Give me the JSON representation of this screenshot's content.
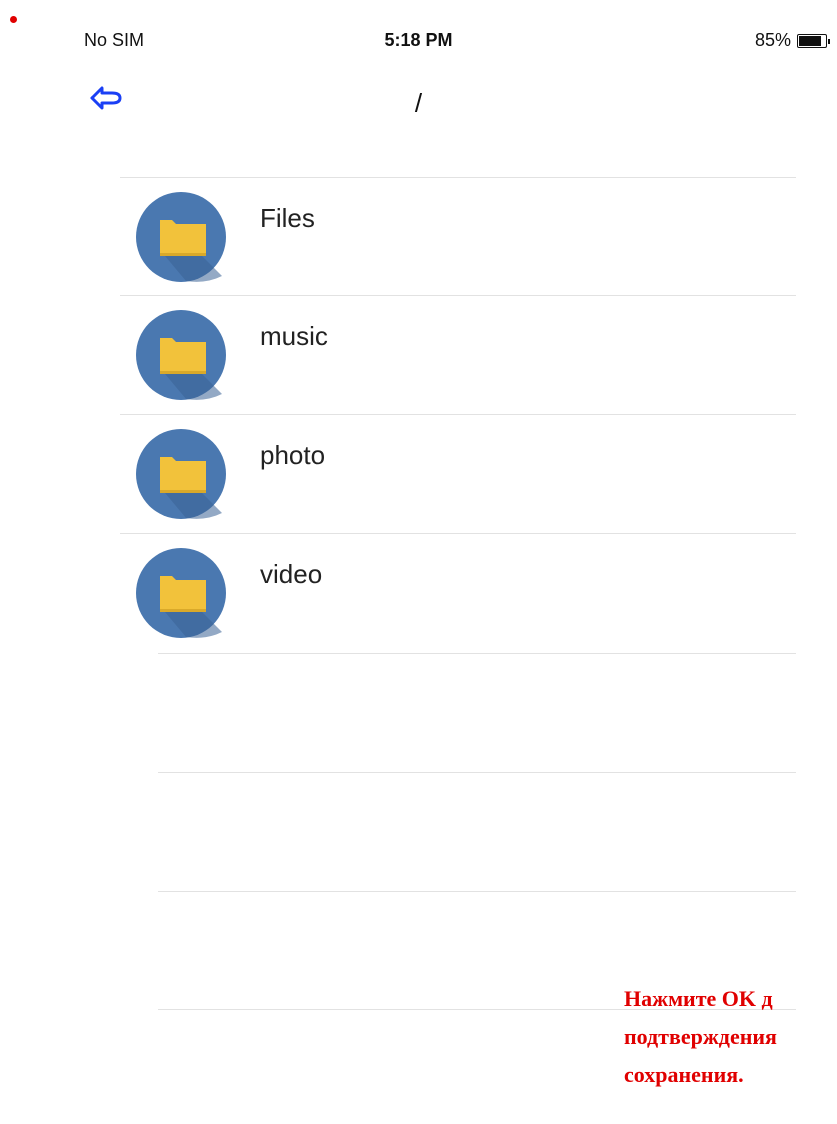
{
  "status_bar": {
    "carrier": "No SIM",
    "time": "5:18 PM",
    "battery_percent_text": "85%",
    "battery_level": 0.85
  },
  "nav": {
    "back_icon": "back-arrow-icon",
    "title": "/"
  },
  "folders": [
    {
      "label": "Files",
      "icon": "folder-icon"
    },
    {
      "label": "music",
      "icon": "folder-icon"
    },
    {
      "label": "photo",
      "icon": "folder-icon"
    },
    {
      "label": "video",
      "icon": "folder-icon"
    }
  ],
  "notice": {
    "line1": "Нажмите OK д",
    "line2": "подтверждения",
    "line3": "сохранения."
  },
  "colors": {
    "accent": "#1a3ff5",
    "folder_circle": "#4a78b0",
    "folder": "#f2c23b",
    "notice": "#e00000"
  }
}
